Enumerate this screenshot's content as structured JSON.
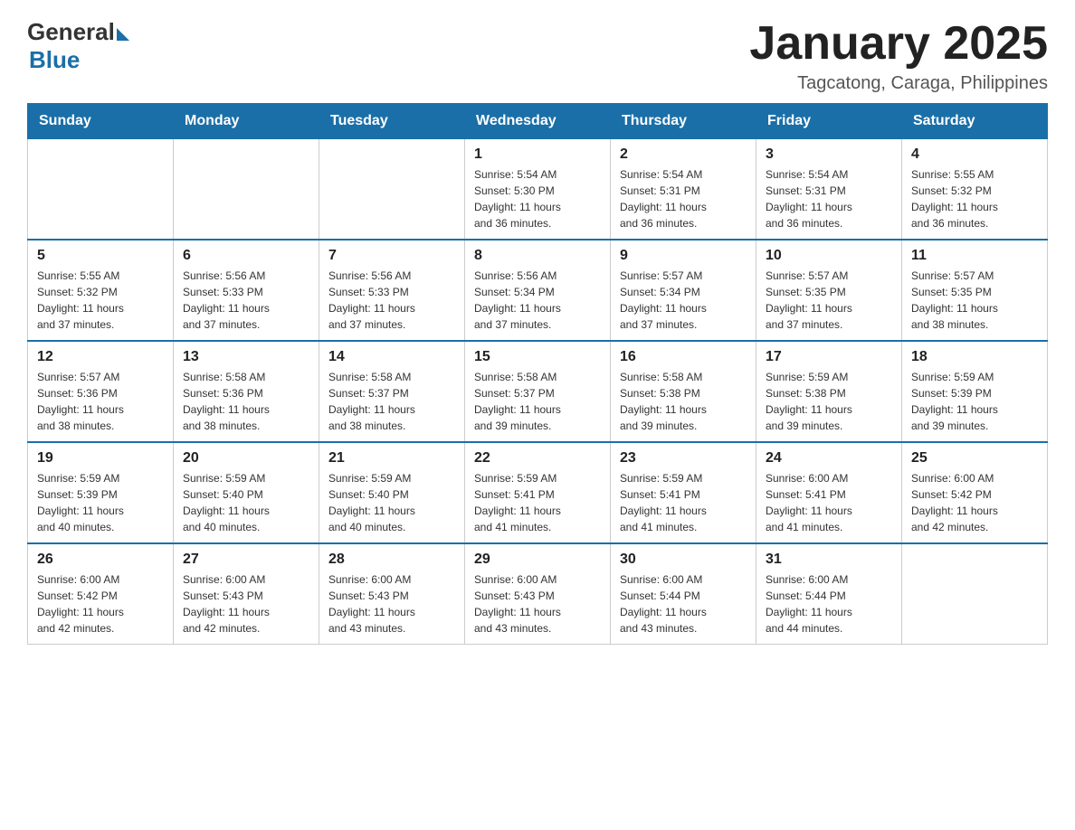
{
  "header": {
    "logo_general": "General",
    "logo_blue": "Blue",
    "title": "January 2025",
    "subtitle": "Tagcatong, Caraga, Philippines"
  },
  "days_of_week": [
    "Sunday",
    "Monday",
    "Tuesday",
    "Wednesday",
    "Thursday",
    "Friday",
    "Saturday"
  ],
  "weeks": [
    [
      {
        "day": "",
        "info": ""
      },
      {
        "day": "",
        "info": ""
      },
      {
        "day": "",
        "info": ""
      },
      {
        "day": "1",
        "info": "Sunrise: 5:54 AM\nSunset: 5:30 PM\nDaylight: 11 hours\nand 36 minutes."
      },
      {
        "day": "2",
        "info": "Sunrise: 5:54 AM\nSunset: 5:31 PM\nDaylight: 11 hours\nand 36 minutes."
      },
      {
        "day": "3",
        "info": "Sunrise: 5:54 AM\nSunset: 5:31 PM\nDaylight: 11 hours\nand 36 minutes."
      },
      {
        "day": "4",
        "info": "Sunrise: 5:55 AM\nSunset: 5:32 PM\nDaylight: 11 hours\nand 36 minutes."
      }
    ],
    [
      {
        "day": "5",
        "info": "Sunrise: 5:55 AM\nSunset: 5:32 PM\nDaylight: 11 hours\nand 37 minutes."
      },
      {
        "day": "6",
        "info": "Sunrise: 5:56 AM\nSunset: 5:33 PM\nDaylight: 11 hours\nand 37 minutes."
      },
      {
        "day": "7",
        "info": "Sunrise: 5:56 AM\nSunset: 5:33 PM\nDaylight: 11 hours\nand 37 minutes."
      },
      {
        "day": "8",
        "info": "Sunrise: 5:56 AM\nSunset: 5:34 PM\nDaylight: 11 hours\nand 37 minutes."
      },
      {
        "day": "9",
        "info": "Sunrise: 5:57 AM\nSunset: 5:34 PM\nDaylight: 11 hours\nand 37 minutes."
      },
      {
        "day": "10",
        "info": "Sunrise: 5:57 AM\nSunset: 5:35 PM\nDaylight: 11 hours\nand 37 minutes."
      },
      {
        "day": "11",
        "info": "Sunrise: 5:57 AM\nSunset: 5:35 PM\nDaylight: 11 hours\nand 38 minutes."
      }
    ],
    [
      {
        "day": "12",
        "info": "Sunrise: 5:57 AM\nSunset: 5:36 PM\nDaylight: 11 hours\nand 38 minutes."
      },
      {
        "day": "13",
        "info": "Sunrise: 5:58 AM\nSunset: 5:36 PM\nDaylight: 11 hours\nand 38 minutes."
      },
      {
        "day": "14",
        "info": "Sunrise: 5:58 AM\nSunset: 5:37 PM\nDaylight: 11 hours\nand 38 minutes."
      },
      {
        "day": "15",
        "info": "Sunrise: 5:58 AM\nSunset: 5:37 PM\nDaylight: 11 hours\nand 39 minutes."
      },
      {
        "day": "16",
        "info": "Sunrise: 5:58 AM\nSunset: 5:38 PM\nDaylight: 11 hours\nand 39 minutes."
      },
      {
        "day": "17",
        "info": "Sunrise: 5:59 AM\nSunset: 5:38 PM\nDaylight: 11 hours\nand 39 minutes."
      },
      {
        "day": "18",
        "info": "Sunrise: 5:59 AM\nSunset: 5:39 PM\nDaylight: 11 hours\nand 39 minutes."
      }
    ],
    [
      {
        "day": "19",
        "info": "Sunrise: 5:59 AM\nSunset: 5:39 PM\nDaylight: 11 hours\nand 40 minutes."
      },
      {
        "day": "20",
        "info": "Sunrise: 5:59 AM\nSunset: 5:40 PM\nDaylight: 11 hours\nand 40 minutes."
      },
      {
        "day": "21",
        "info": "Sunrise: 5:59 AM\nSunset: 5:40 PM\nDaylight: 11 hours\nand 40 minutes."
      },
      {
        "day": "22",
        "info": "Sunrise: 5:59 AM\nSunset: 5:41 PM\nDaylight: 11 hours\nand 41 minutes."
      },
      {
        "day": "23",
        "info": "Sunrise: 5:59 AM\nSunset: 5:41 PM\nDaylight: 11 hours\nand 41 minutes."
      },
      {
        "day": "24",
        "info": "Sunrise: 6:00 AM\nSunset: 5:41 PM\nDaylight: 11 hours\nand 41 minutes."
      },
      {
        "day": "25",
        "info": "Sunrise: 6:00 AM\nSunset: 5:42 PM\nDaylight: 11 hours\nand 42 minutes."
      }
    ],
    [
      {
        "day": "26",
        "info": "Sunrise: 6:00 AM\nSunset: 5:42 PM\nDaylight: 11 hours\nand 42 minutes."
      },
      {
        "day": "27",
        "info": "Sunrise: 6:00 AM\nSunset: 5:43 PM\nDaylight: 11 hours\nand 42 minutes."
      },
      {
        "day": "28",
        "info": "Sunrise: 6:00 AM\nSunset: 5:43 PM\nDaylight: 11 hours\nand 43 minutes."
      },
      {
        "day": "29",
        "info": "Sunrise: 6:00 AM\nSunset: 5:43 PM\nDaylight: 11 hours\nand 43 minutes."
      },
      {
        "day": "30",
        "info": "Sunrise: 6:00 AM\nSunset: 5:44 PM\nDaylight: 11 hours\nand 43 minutes."
      },
      {
        "day": "31",
        "info": "Sunrise: 6:00 AM\nSunset: 5:44 PM\nDaylight: 11 hours\nand 44 minutes."
      },
      {
        "day": "",
        "info": ""
      }
    ]
  ]
}
